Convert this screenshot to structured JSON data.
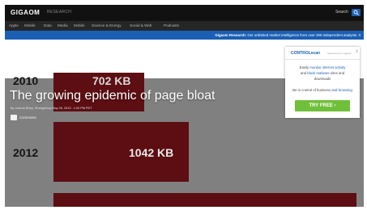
{
  "topbar": {
    "logo": "GIGAOM",
    "section": "RESEARCH",
    "search_label": "Search"
  },
  "nav": {
    "items": [
      "Apple",
      "Mobile",
      "Data",
      "Media",
      "Mobile",
      "Science & Energy",
      "Social & Web",
      "Podcasts"
    ]
  },
  "promo": {
    "lead": "Gigaom Research:",
    "text": " Get unlimited market intelligence from over 200 independent analysts. It"
  },
  "chart_data": {
    "type": "bar",
    "categories": [
      "2010",
      "2012"
    ],
    "values": [
      702,
      1042
    ],
    "value_labels": [
      "702 KB",
      "1042 KB"
    ],
    "unit": "KB",
    "bar_color": "#5c0e12"
  },
  "article": {
    "headline": "The growing epidemic of page bloat",
    "byline": "By Joshua Bixby, Strangeloop     May 26, 2013 - 1:00 PM PDT",
    "comments_label": "Comments"
  },
  "ad": {
    "brand": "CONTROLscan",
    "tag": "Sponsored by Gigaom",
    "close": "x",
    "line1_pre": "Easily ",
    "line1_link": "monitor internet activity",
    "line2_pre": "and ",
    "line2_link": "block malware",
    "line2_post": " sites and",
    "line3": "downloads",
    "line4_pre": "Be in control of business ",
    "line4_link": "and browsing",
    "button": "TRY FREE ›"
  },
  "colors": {
    "topbar": "#111111",
    "navbar": "#262626",
    "promo": "#1a5fb4",
    "bar": "#5c0e12",
    "cta": "#6fbf3a"
  }
}
